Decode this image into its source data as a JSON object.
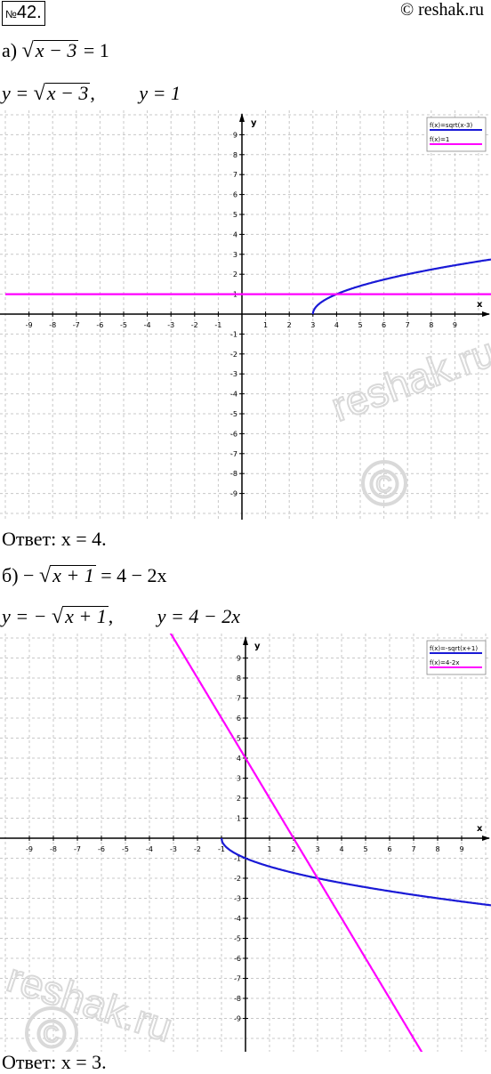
{
  "header": {
    "number_sign": "№",
    "number": "42.",
    "site": "© reshak.ru"
  },
  "part_a": {
    "label": "а)",
    "eq_rad": "x − 3",
    "eq_rhs": "= 1",
    "funcs_left": "y =",
    "funcs_rad": "x − 3",
    "funcs_sep": ",",
    "funcs_right": "y = 1",
    "answer": "Ответ: x = 4."
  },
  "part_b": {
    "label": "б) −",
    "eq_rad": "x + 1",
    "eq_rhs": "= 4 − 2x",
    "funcs_left": "y = −",
    "funcs_rad": "x + 1",
    "funcs_sep": ",",
    "funcs_right": "y = 4 − 2x",
    "answer": "Ответ: x = 3."
  },
  "watermark": {
    "text": "reshak.ru",
    "symbol": "©"
  },
  "colors": {
    "curve": "#1a1ad6",
    "line": "#ff00ff",
    "grid": "#c8c8c8"
  },
  "chart_data": [
    {
      "type": "line",
      "xlabel": "x",
      "ylabel": "y",
      "xlim": [
        -10,
        10
      ],
      "ylim": [
        -10,
        10
      ],
      "grid": true,
      "legend_position": "top-right",
      "ticks": [
        -9,
        -8,
        -7,
        -6,
        -5,
        -4,
        -3,
        -2,
        -1,
        1,
        2,
        3,
        4,
        5,
        6,
        7,
        8,
        9
      ],
      "series": [
        {
          "name": "f(x)=sqrt(x-3)",
          "func": "sqrt(x-3)",
          "x": [
            3,
            3.25,
            4,
            7,
            12,
            19
          ],
          "y": [
            0,
            0.5,
            1,
            2,
            3,
            4
          ],
          "color": "#1a1ad6"
        },
        {
          "name": "f(x)=1",
          "func": "1",
          "x": [
            -10,
            10
          ],
          "y": [
            1,
            1
          ],
          "color": "#ff00ff"
        }
      ]
    },
    {
      "type": "line",
      "xlabel": "x",
      "ylabel": "y",
      "xlim": [
        -10,
        10
      ],
      "ylim": [
        -10,
        10
      ],
      "grid": true,
      "legend_position": "top-right",
      "ticks": [
        -9,
        -8,
        -7,
        -6,
        -5,
        -4,
        -3,
        -2,
        -1,
        1,
        2,
        3,
        4,
        5,
        6,
        7,
        8,
        9
      ],
      "series": [
        {
          "name": "f(x)=-sqrt(x+1)",
          "func": "-sqrt(x+1)",
          "x": [
            -1,
            0,
            3,
            8,
            15,
            24
          ],
          "y": [
            0,
            -1,
            -2,
            -3,
            -4,
            -5
          ],
          "color": "#1a1ad6"
        },
        {
          "name": "f(x)=4-2x",
          "func": "4-2x",
          "x": [
            -3,
            2,
            7
          ],
          "y": [
            10,
            0,
            -10
          ],
          "color": "#ff00ff"
        }
      ]
    }
  ]
}
